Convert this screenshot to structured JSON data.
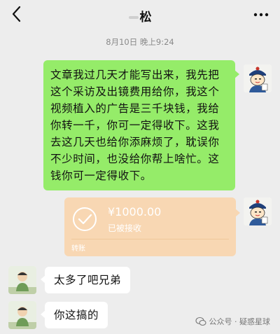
{
  "header": {
    "title": "松",
    "back_icon": "chevron-left-icon",
    "more_icon": "more-dots-icon"
  },
  "timestamp": "8月10日 晚上9:24",
  "messages": {
    "long_text": "文章我过几天才能写出来，我先把这个采访及出镜费用给你，我这个视频植入的广告是三千块钱，我给你转一千，你可一定得收下。这我去这几天也给你添麻烦了，耽误你不少时间，也没给你帮上啥忙。这钱你可一定得收下。",
    "transfer": {
      "amount": "¥1000.00",
      "status": "已被接收",
      "label": "转账",
      "icon": "check-circle-icon"
    },
    "reply1": "太多了吧兄弟",
    "reply2": "你这搞的"
  },
  "watermark": {
    "text": "公众号 · 疑惑星球",
    "icon": "wechat-icon"
  },
  "colors": {
    "background": "#ededed",
    "sent_bubble": "#95ec69",
    "transfer_card": "#f8d7b3",
    "received_bubble": "#ffffff"
  }
}
